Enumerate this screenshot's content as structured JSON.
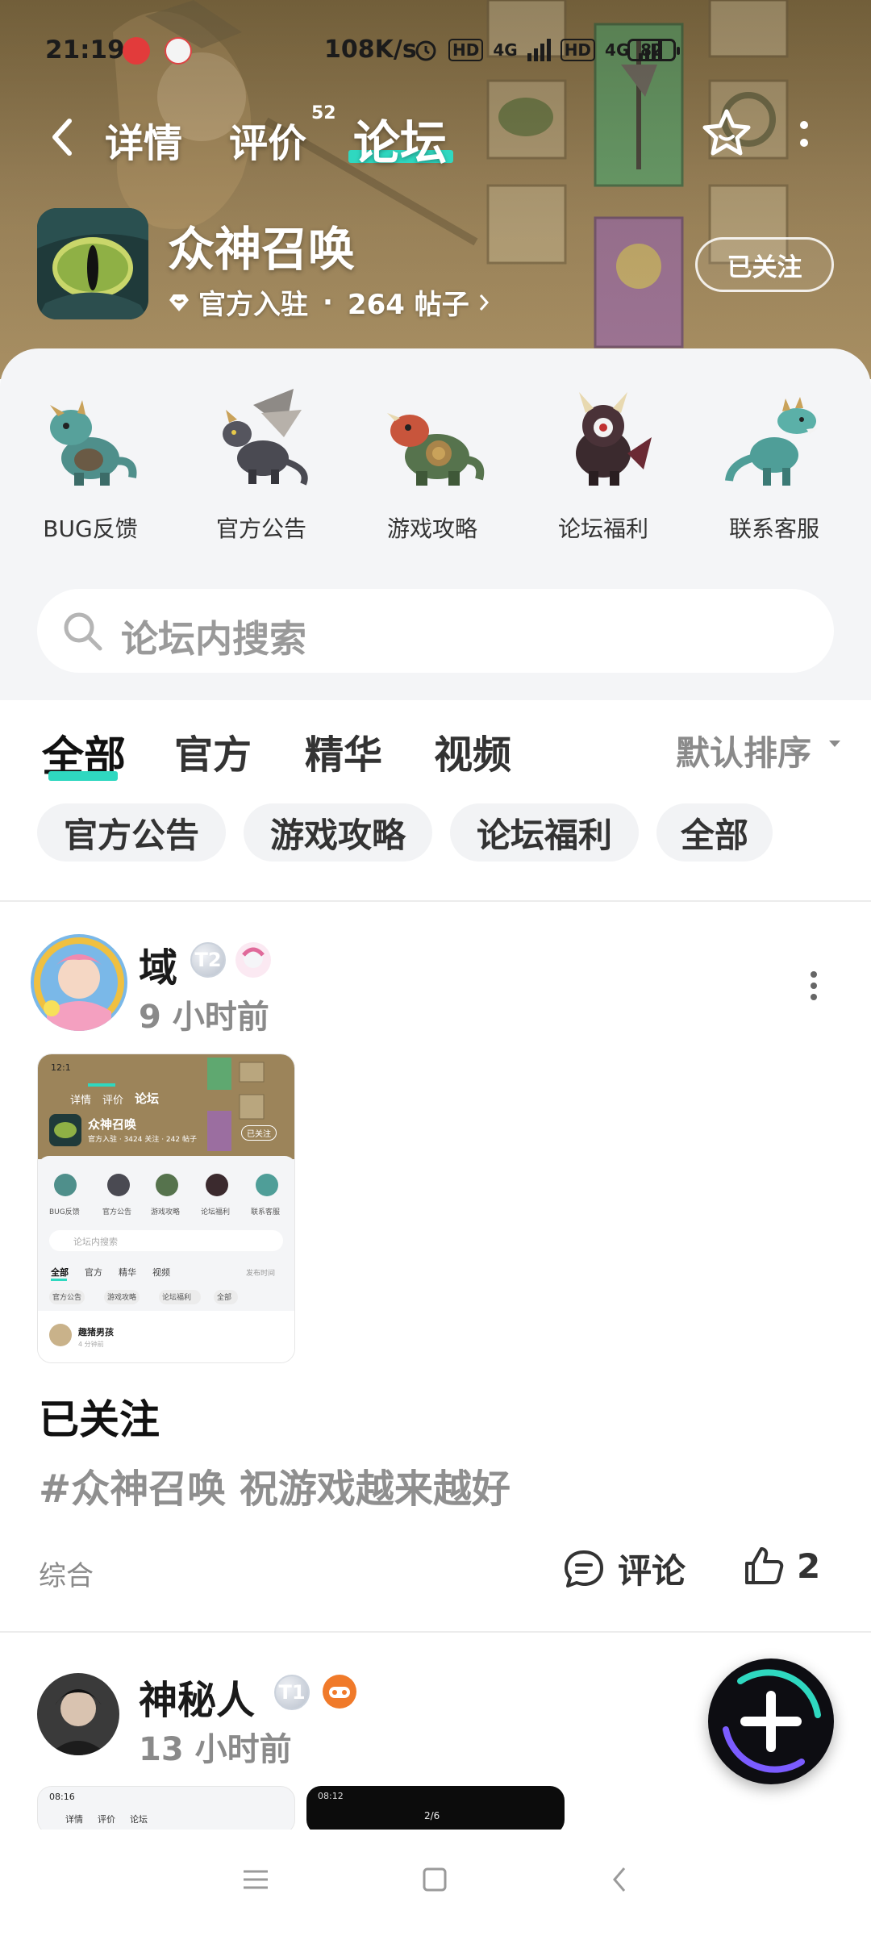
{
  "status_bar": {
    "time": "21:19",
    "speed": "108K/s",
    "hd1": "HD",
    "net1": "4G",
    "hd2": "HD",
    "net2": "4G",
    "battery": "82"
  },
  "nav": {
    "tabs": [
      "详情",
      "评价",
      "论坛"
    ],
    "review_count": "52",
    "active_tab": "论坛"
  },
  "game": {
    "title": "众神召唤",
    "official": "官方入驻",
    "separator": "·",
    "posts": "264 帖子",
    "follow_label": "已关注"
  },
  "shortcuts": [
    {
      "label": "BUG反馈",
      "icon": "teal-dragon"
    },
    {
      "label": "官方公告",
      "icon": "winged-dragon"
    },
    {
      "label": "游戏攻略",
      "icon": "armored-beast"
    },
    {
      "label": "论坛福利",
      "icon": "horned-demon"
    },
    {
      "label": "联系客服",
      "icon": "green-dinosaur"
    }
  ],
  "search": {
    "placeholder": "论坛内搜索"
  },
  "feed_tabs": [
    "全部",
    "官方",
    "精华",
    "视频"
  ],
  "sort_label": "默认排序",
  "filter_chips": [
    "官方公告",
    "游戏攻略",
    "论坛福利",
    "全部"
  ],
  "posts": [
    {
      "author": "域",
      "level": "T2",
      "time": "9 小时前",
      "title": "已关注",
      "body": "#众神召唤 祝游戏越来越好",
      "category": "综合",
      "comment_label": "评论",
      "likes": "2"
    },
    {
      "author": "神秘人",
      "level": "T1",
      "time": "13 小时前"
    }
  ],
  "thumbnail": {
    "time": "12:1",
    "tabs": [
      "详情",
      "评价",
      "论坛"
    ],
    "title": "众神召唤",
    "meta": "官方入驻 · 3424 关注 · 242 帖子",
    "follow": "已关注",
    "shortcuts": [
      "BUG反馈",
      "官方公告",
      "游戏攻略",
      "论坛福利",
      "联系客服"
    ],
    "search": "论坛内搜索",
    "feed_tabs": [
      "全部",
      "官方",
      "精华",
      "视频"
    ],
    "sort": "发布时间",
    "chips": [
      "官方公告",
      "游戏攻略",
      "论坛福利",
      "全部"
    ],
    "user": "趣猪男孩",
    "user_time": "4 分钟前"
  },
  "thumbnail2": {
    "time_a": "08:16",
    "tabs_a": [
      "详情",
      "评价",
      "论坛"
    ],
    "time_b": "08:12",
    "counter_b": "2/6"
  },
  "colors": {
    "accent": "#2fd8c0",
    "header_bg": "#9c845a",
    "panel_bg": "#f4f5f7"
  }
}
